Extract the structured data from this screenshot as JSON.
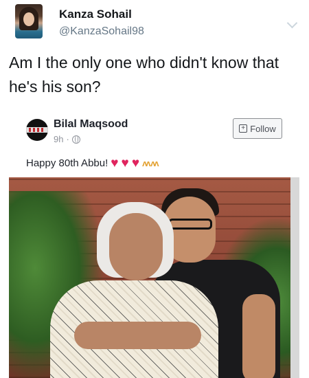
{
  "tweet": {
    "author_name": "Kanza Sohail",
    "author_handle": "@KanzaSohail98",
    "text": "Am I the only one who didn't know that he's his son?"
  },
  "embedded_post": {
    "author_name": "Bilal Maqsood",
    "time": "9h",
    "separator": "·",
    "follow_label": "Follow",
    "text": "Happy 80th Abbu!",
    "reaction_icons": [
      "heart-icon",
      "heart-icon",
      "heart-icon",
      "praying-hands-icon"
    ]
  },
  "colors": {
    "handle_gray": "#657786",
    "heart_red": "#e0245e",
    "follow_border": "#8a8d91"
  }
}
